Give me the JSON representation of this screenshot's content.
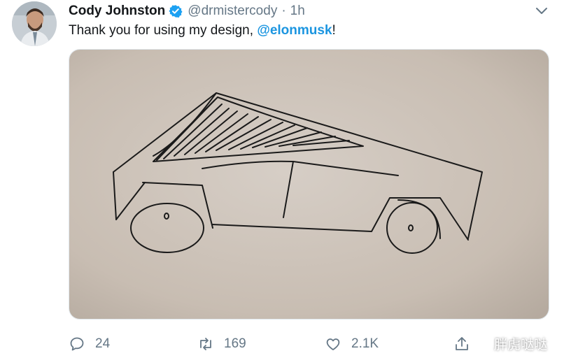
{
  "author": {
    "display_name": "Cody Johnston",
    "handle": "@drmistercody",
    "separator": "·",
    "time": "1h",
    "verified": true
  },
  "tweet": {
    "text_before": "Thank you for using my design, ",
    "mention": "@elonmusk",
    "text_after": "!"
  },
  "actions": {
    "replies": "24",
    "retweets": "169",
    "likes": "2.1K"
  },
  "watermark": {
    "text": "胖虎哒哒"
  },
  "colors": {
    "accent": "#1b95e0",
    "verified_badge": "#1da1f2",
    "muted": "#657786",
    "paper": "#c9beb3"
  },
  "icons": {
    "reply": "reply-icon",
    "retweet": "retweet-icon",
    "like": "heart-icon",
    "share": "share-icon",
    "more": "chevron-down-icon",
    "verified": "verified-badge-icon"
  }
}
